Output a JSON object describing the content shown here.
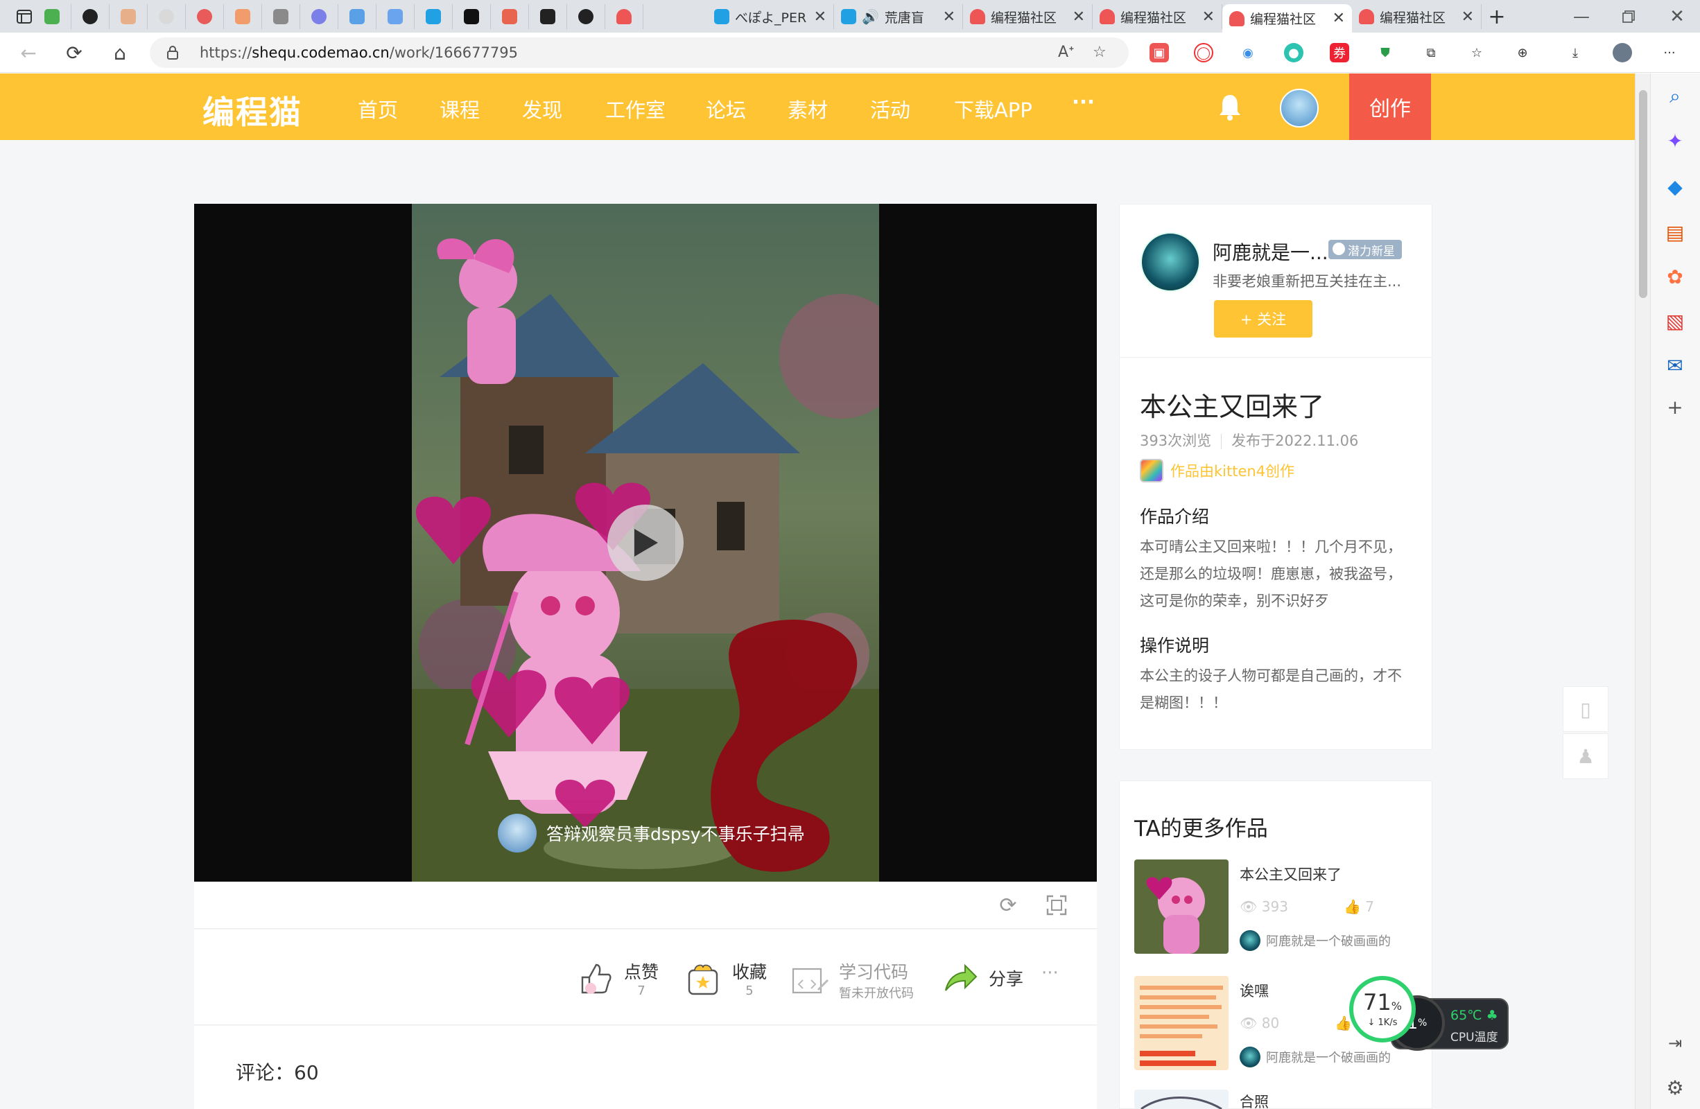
{
  "browser": {
    "tabs": [
      {
        "label": "べぽよ_PER",
        "kind": "bilibili"
      },
      {
        "label": "荒唐盲",
        "kind": "bilibili-audio"
      },
      {
        "label": "编程猫社区",
        "kind": "codemao"
      },
      {
        "label": "编程猫社区",
        "kind": "codemao"
      },
      {
        "label": "编程猫社区",
        "kind": "codemao",
        "active": true
      },
      {
        "label": "编程猫社区",
        "kind": "codemao"
      }
    ],
    "url_prefix": "https://",
    "url_host": "shequ.codemao.cn",
    "url_path": "/work/166677795"
  },
  "site": {
    "logo": "编程猫",
    "nav": [
      "首页",
      "课程",
      "发现",
      "工作室",
      "论坛",
      "素材",
      "活动",
      "下载APP"
    ],
    "more": "···",
    "create": "创作",
    "accent": "#fec433",
    "create_color": "#f35a47"
  },
  "player": {
    "barrage_text": "答辩观察员事dspsy不事乐子扫帚"
  },
  "actions": {
    "like": {
      "label": "点赞",
      "count": "7"
    },
    "collect": {
      "label": "收藏",
      "count": "5"
    },
    "code": {
      "label": "学习代码",
      "sub": "暂未开放代码"
    },
    "share": {
      "label": "分享"
    },
    "more": "···"
  },
  "comments": {
    "title": "评论：60"
  },
  "author": {
    "name": "阿鹿就是一...",
    "badge": "潜力新星",
    "signature": "非要老娘重新把互关挂在主...",
    "follow": "+ 关注"
  },
  "work": {
    "title": "本公主又回来了",
    "views": "393次浏览",
    "published": "发布于2022.11.06",
    "made_with": "作品由kitten4创作",
    "intro_heading": "作品介绍",
    "intro_lines": [
      "本可晴公主又回来啦！！！几个月不见，",
      "还是那么的垃圾啊！鹿崽崽，被我盗号，",
      "这可是你的荣幸，别不识好歹"
    ],
    "ops_heading": "操作说明",
    "ops_lines": [
      "本公主的设子人物可都是自己画的，才不",
      "是糊图！！！"
    ]
  },
  "more_works": {
    "title": "TA的更多作品",
    "items": [
      {
        "title": "本公主又回来了",
        "views": "393",
        "likes": "7",
        "author": "阿鹿就是一个破画画的"
      },
      {
        "title": "诶嘿",
        "views": "80",
        "likes": "",
        "author": "阿鹿就是一个破画画的"
      },
      {
        "title": "合照",
        "views": "",
        "likes": "",
        "author": ""
      }
    ]
  },
  "cpu_widget": {
    "usage": "71",
    "usage_unit": "%",
    "speed": "1K/s",
    "mem": "1",
    "mem_unit": "%",
    "temp": "65℃",
    "temp_label": "CPU温度"
  }
}
